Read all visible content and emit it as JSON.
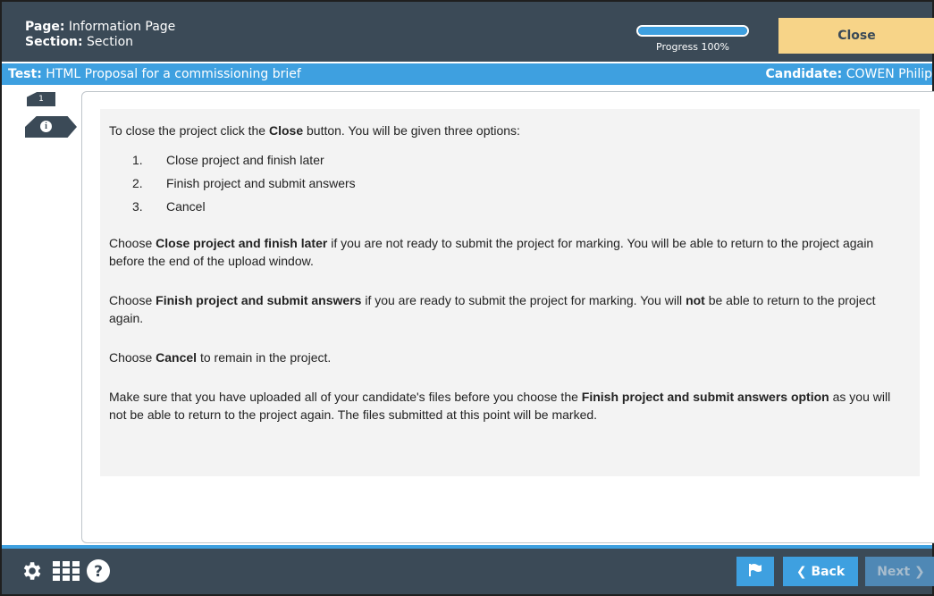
{
  "header": {
    "page_label": "Page:",
    "page_value": "Information Page",
    "section_label": "Section:",
    "section_value": "Section",
    "progress_label": "Progress 100%",
    "progress_fraction": 1.0,
    "close_label": "Close"
  },
  "subbar": {
    "test_label": "Test:",
    "test_value": "HTML Proposal for a commissioning brief",
    "candidate_label": "Candidate:",
    "candidate_value": "COWEN Philip"
  },
  "nav": {
    "page_number": "1",
    "info_icon": "info-circle-icon"
  },
  "content": {
    "intro_pre": "To close the project click the ",
    "intro_bold": "Close",
    "intro_post": " button. You will be given three options:",
    "options": [
      {
        "num": "1.",
        "text": "Close project and finish later"
      },
      {
        "num": "2.",
        "text": "Finish project and submit answers"
      },
      {
        "num": "3.",
        "text": "Cancel"
      }
    ],
    "p1_pre": "Choose ",
    "p1_bold": "Close project and finish later",
    "p1_post": " if you are not ready to submit the project for marking. You will be able to return to the project again before the end of the upload window.",
    "p2_pre": "Choose ",
    "p2_bold": "Finish project and submit answers",
    "p2_mid": " if you are ready to submit the project for marking. You will ",
    "p2_bold2": "not",
    "p2_post": " be able to return to the project again.",
    "p3_pre": "Choose ",
    "p3_bold": "Cancel",
    "p3_post": " to remain in the project.",
    "p4_pre": "Make sure that you have uploaded all of your candidate's files before you choose the ",
    "p4_bold": "Finish project and submit answers option",
    "p4_post": " as you will not be able to return to the project again. The files submitted at this point will be marked."
  },
  "footer": {
    "settings_icon": "gear-icon",
    "grid_icon": "grid-icon",
    "help_icon": "help-circle-icon",
    "flag_icon": "flag-icon",
    "back_label": "Back",
    "next_label": "Next"
  },
  "colors": {
    "header_bg": "#3b4a57",
    "accent_blue": "#3ea0e0",
    "close_button": "#f7d488"
  }
}
